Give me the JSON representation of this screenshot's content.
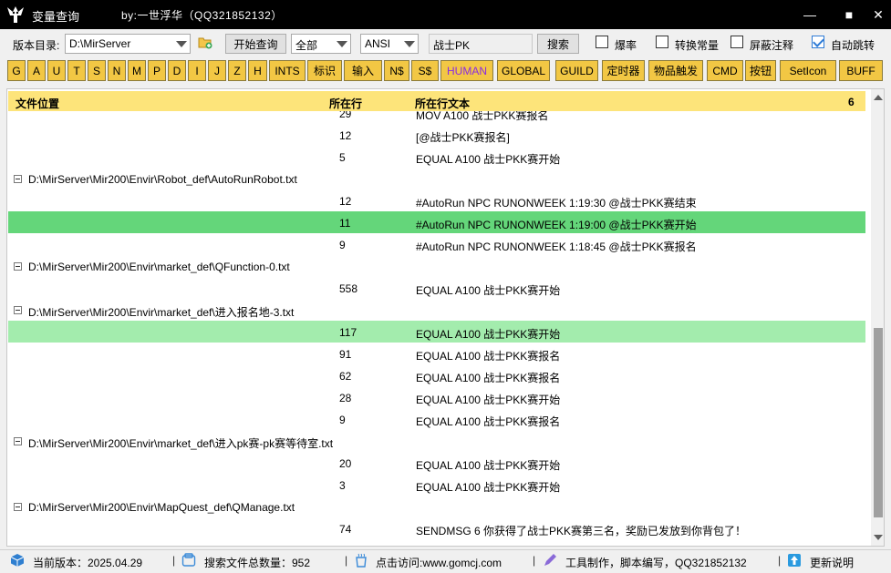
{
  "titlebar": {
    "title": "变量查询",
    "byline": "by:一世浮华（QQ321852132）",
    "min_glyph": "—",
    "max_glyph": "■",
    "close_glyph": "✕"
  },
  "toolbar": {
    "version_dir_label": "版本目录:",
    "version_dir_value": "D:\\MirServer",
    "start_query_label": "开始查询",
    "scope_value": "全部",
    "encoding_value": "ANSI",
    "search_value": "战士PK",
    "search_button_label": "搜索",
    "checkboxes": [
      {
        "label": "爆率",
        "checked": false
      },
      {
        "label": "转换常量",
        "checked": false
      },
      {
        "label": "屏蔽注释",
        "checked": false
      },
      {
        "label": "自动跳转",
        "checked": true
      }
    ]
  },
  "filters": [
    "G",
    "A",
    "U",
    "T",
    "S",
    "N",
    "M",
    "P",
    "D",
    "I",
    "J",
    "Z",
    "H",
    "INTS",
    "标识",
    "输入",
    "N$",
    "S$",
    "HUMAN",
    "GLOBAL",
    "GUILD",
    "定时器",
    "物品触发",
    "CMD",
    "按钮",
    "SetIcon",
    "BUFF"
  ],
  "results": {
    "col_file": "文件位置",
    "col_line": "所在行",
    "col_text": "所在行文本",
    "count": "6",
    "rows": [
      {
        "kind": "line",
        "line": "29",
        "text": "MOV A100 战士PKK赛报名"
      },
      {
        "kind": "line",
        "line": "12",
        "text": "[@战士PKK赛报名]"
      },
      {
        "kind": "line",
        "line": "5",
        "text": "EQUAL A100 战士PKK赛开始"
      },
      {
        "kind": "file",
        "path": "D:\\MirServer\\Mir200\\Envir\\Robot_def\\AutoRunRobot.txt"
      },
      {
        "kind": "line",
        "line": "12",
        "text": "#AutoRun NPC RUNONWEEK 1:19:30 @战士PKK赛结束"
      },
      {
        "kind": "line",
        "line": "11",
        "text": "#AutoRun NPC RUNONWEEK 1:19:00 @战士PKK赛开始",
        "highlight": "strong"
      },
      {
        "kind": "line",
        "line": "9",
        "text": "#AutoRun NPC RUNONWEEK 1:18:45 @战士PKK赛报名"
      },
      {
        "kind": "file",
        "path": "D:\\MirServer\\Mir200\\Envir\\market_def\\QFunction-0.txt"
      },
      {
        "kind": "line",
        "line": "558",
        "text": "EQUAL A100 战士PKK赛开始"
      },
      {
        "kind": "file",
        "path": "D:\\MirServer\\Mir200\\Envir\\market_def\\进入报名地-3.txt"
      },
      {
        "kind": "line",
        "line": "117",
        "text": "EQUAL A100 战士PKK赛开始",
        "highlight": "light"
      },
      {
        "kind": "line",
        "line": "91",
        "text": "EQUAL A100 战士PKK赛报名"
      },
      {
        "kind": "line",
        "line": "62",
        "text": "EQUAL A100 战士PKK赛报名"
      },
      {
        "kind": "line",
        "line": "28",
        "text": "EQUAL A100 战士PKK赛开始"
      },
      {
        "kind": "line",
        "line": "9",
        "text": "EQUAL A100 战士PKK赛报名"
      },
      {
        "kind": "file",
        "path": "D:\\MirServer\\Mir200\\Envir\\market_def\\进入pk赛-pk赛等待室.txt"
      },
      {
        "kind": "line",
        "line": "20",
        "text": "EQUAL A100 战士PKK赛开始"
      },
      {
        "kind": "line",
        "line": "3",
        "text": "EQUAL A100 战士PKK赛开始"
      },
      {
        "kind": "file",
        "path": "D:\\MirServer\\Mir200\\Envir\\MapQuest_def\\QManage.txt"
      },
      {
        "kind": "line",
        "line": "74",
        "text": "SENDMSG 6 你获得了战士PKK赛第三名，奖励已发放到你背包了！"
      }
    ]
  },
  "status": {
    "version": "当前版本：2025.04.29",
    "file_count": "搜索文件总数量：952",
    "visit": "点击访问:www.gomcj.com",
    "author": "工具制作，脚本编写，QQ321852132",
    "update": "更新说明"
  }
}
